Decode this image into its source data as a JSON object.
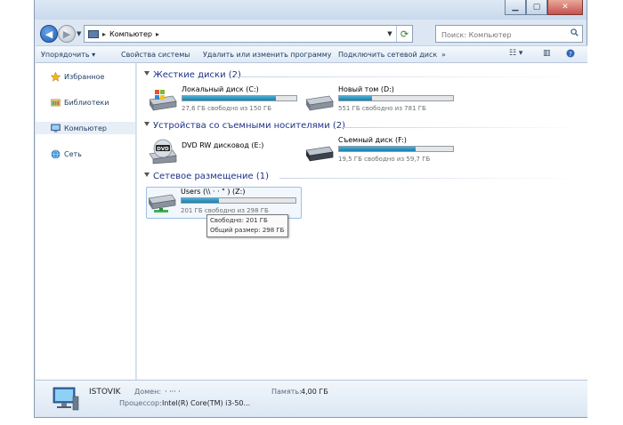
{
  "address": {
    "location": "Компьютер"
  },
  "search": {
    "placeholder": "Поиск: Компьютер"
  },
  "toolbar": {
    "organize": "Упорядочить",
    "system_properties": "Свойства системы",
    "uninstall": "Удалить или изменить программу",
    "map_drive": "Подключить сетевой диск",
    "more": "»"
  },
  "sidebar": {
    "items": [
      {
        "label": "Избранное",
        "icon": "star-icon"
      },
      {
        "label": "Библиотеки",
        "icon": "library-icon"
      },
      {
        "label": "Компьютер",
        "icon": "computer-icon",
        "selected": true
      },
      {
        "label": "Сеть",
        "icon": "network-icon"
      }
    ]
  },
  "groups": {
    "hard_disks": "Жесткие диски (2)",
    "removable": "Устройства со съемными носителями (2)",
    "network": "Сетевое размещение (1)"
  },
  "drives": {
    "c": {
      "name": "Локальный диск (C:)",
      "free": "27,6 ГБ свободно из 150 ГБ",
      "used_fraction": 0.82
    },
    "d": {
      "name": "Новый том (D:)",
      "free": "551 ГБ свободно из 781 ГБ",
      "used_fraction": 0.29
    },
    "e": {
      "name": "DVD RW дисковод (E:)"
    },
    "f": {
      "name": "Съемный диск (F:)",
      "free": "19,5 ГБ свободно из 59,7 ГБ",
      "used_fraction": 0.67
    },
    "z": {
      "name": "Users (\\\\  ·  · \" ) (Z:)",
      "free": "201 ГБ свободно из 298 ГБ",
      "used_fraction": 0.33
    }
  },
  "tooltip": {
    "free": "Свободно: 201 ГБ",
    "total": "Общий размер: 298 ГБ"
  },
  "details": {
    "computer_name": "ISTOVIK",
    "domain_label": "Домен:",
    "domain_value": "· ··· ·",
    "memory_label": "Память:",
    "memory_value": "4,00 ГБ",
    "cpu_label": "Процессор:",
    "cpu_value": "Intel(R) Core(TM) i3-50..."
  },
  "colors": {
    "bar_fill": "#1a7ea8",
    "header_text": "#1e3287"
  }
}
